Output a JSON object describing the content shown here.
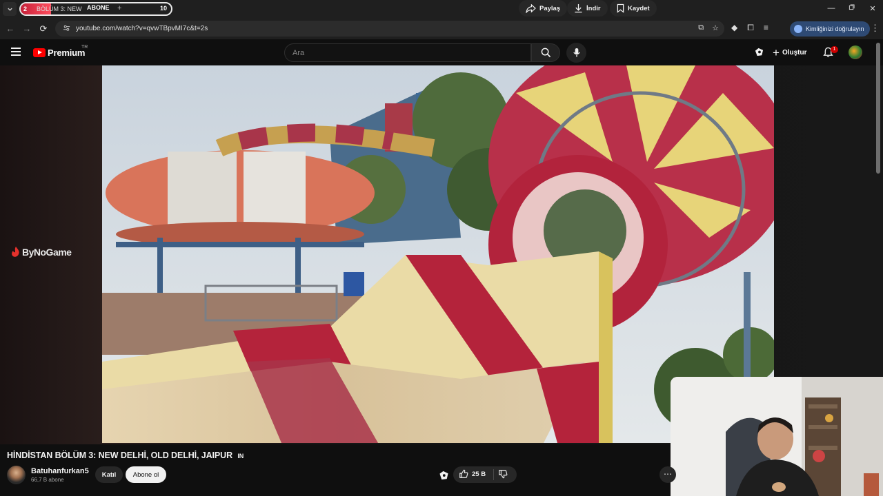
{
  "browser": {
    "tab": {
      "number": "2",
      "title": "BÖLÜM 3: NEW",
      "subscribe_label": "ABONE",
      "counter": "10",
      "progress_fraction": 0.2
    },
    "url": "youtube.com/watch?v=qvwTBpvMI7c&t=2s",
    "verify_label": "Kimliğinizi doğrulayın",
    "window_controls": [
      "minimize-icon",
      "restore-icon",
      "close-icon"
    ]
  },
  "youtube": {
    "logo_text": "Premium",
    "region": "TR",
    "search_placeholder": "Ara",
    "create_label": "Oluştur",
    "notification_count": "1"
  },
  "watermark": "ByNoGame",
  "video": {
    "title": "HİNDİSTAN BÖLÜM 3: NEW DELHİ, OLD DELHİ, JAIPUR",
    "title_badge": "IN",
    "channel_name": "Batuhanfurkan5",
    "subscribers": "66,7 B abone",
    "join_label": "Katıl",
    "subscribe_label": "Abone ol",
    "likes": "25 B",
    "share_label": "Paylaş",
    "download_label": "İndir",
    "save_label": "Kaydet"
  },
  "colors": {
    "yt_red": "#ff0000",
    "background": "#0f0f0f",
    "pill": "#272727",
    "verify_pill": "#2e4a74"
  }
}
